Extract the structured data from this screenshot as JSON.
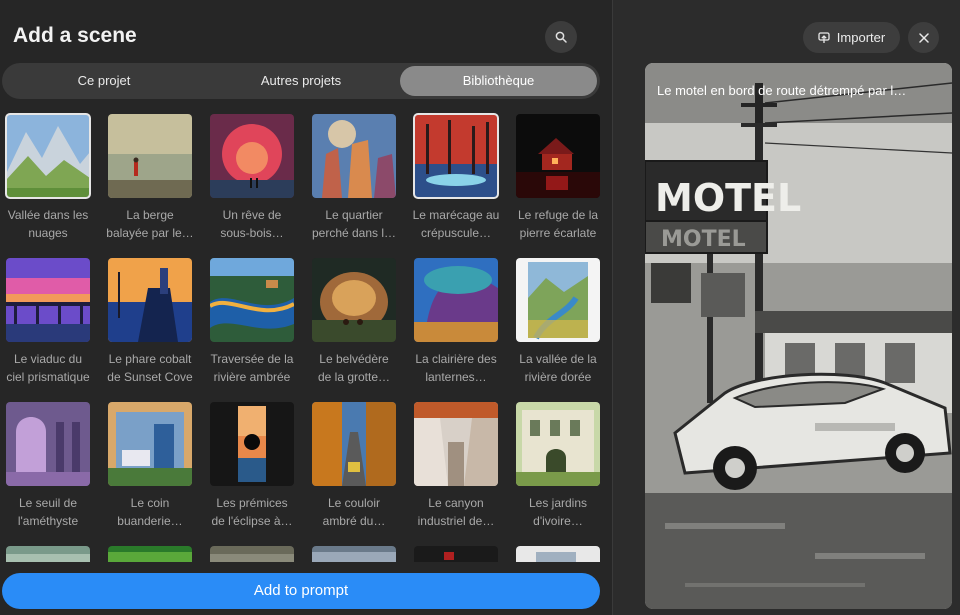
{
  "header": {
    "title": "Add a scene"
  },
  "tabs": [
    {
      "label": "Ce projet",
      "active": false
    },
    {
      "label": "Autres projets",
      "active": false
    },
    {
      "label": "Bibliothèque",
      "active": true
    }
  ],
  "scenes": [
    {
      "line1": "Vallée dans les",
      "line2": "nuages",
      "selected": true
    },
    {
      "line1": "La berge",
      "line2": "balayée par le…",
      "selected": false
    },
    {
      "line1": "Un rêve de",
      "line2": "sous-bois…",
      "selected": false
    },
    {
      "line1": "Le quartier",
      "line2": "perché dans l…",
      "selected": false
    },
    {
      "line1": "Le marécage au",
      "line2": "crépuscule…",
      "selected": true
    },
    {
      "line1": "Le refuge de la",
      "line2": "pierre écarlate",
      "selected": false
    },
    {
      "line1": "Le viaduc du",
      "line2": "ciel prismatique",
      "selected": false
    },
    {
      "line1": "Le phare cobalt",
      "line2": "de Sunset Cove",
      "selected": false
    },
    {
      "line1": "Traversée de la",
      "line2": "rivière ambrée",
      "selected": false
    },
    {
      "line1": "Le belvédère",
      "line2": "de la grotte…",
      "selected": false
    },
    {
      "line1": "La clairière des",
      "line2": "lanternes…",
      "selected": false
    },
    {
      "line1": "La vallée de la",
      "line2": "rivière dorée",
      "selected": false
    },
    {
      "line1": "Le seuil de",
      "line2": "l'améthyste",
      "selected": false
    },
    {
      "line1": "Le coin",
      "line2": "buanderie…",
      "selected": false
    },
    {
      "line1": "Les prémices",
      "line2": "de l'éclipse à…",
      "selected": false
    },
    {
      "line1": "Le couloir",
      "line2": "ambré du…",
      "selected": false
    },
    {
      "line1": "Le canyon",
      "line2": "industriel de…",
      "selected": false
    },
    {
      "line1": "Les jardins",
      "line2": "d'ivoire…",
      "selected": false
    }
  ],
  "footer": {
    "add_label": "Add to prompt"
  },
  "preview": {
    "import_label": "Importer",
    "title": "Le motel en bord de route détrempé par l…",
    "sign_top": "MOTEL",
    "sign_bottom": "MOTEL"
  },
  "colors": {
    "accent": "#2a8cf7",
    "active_tab": "#8a8a8a",
    "background": "#262626"
  },
  "icons": {
    "search": "search-icon",
    "import": "import-icon",
    "close": "close-icon"
  }
}
